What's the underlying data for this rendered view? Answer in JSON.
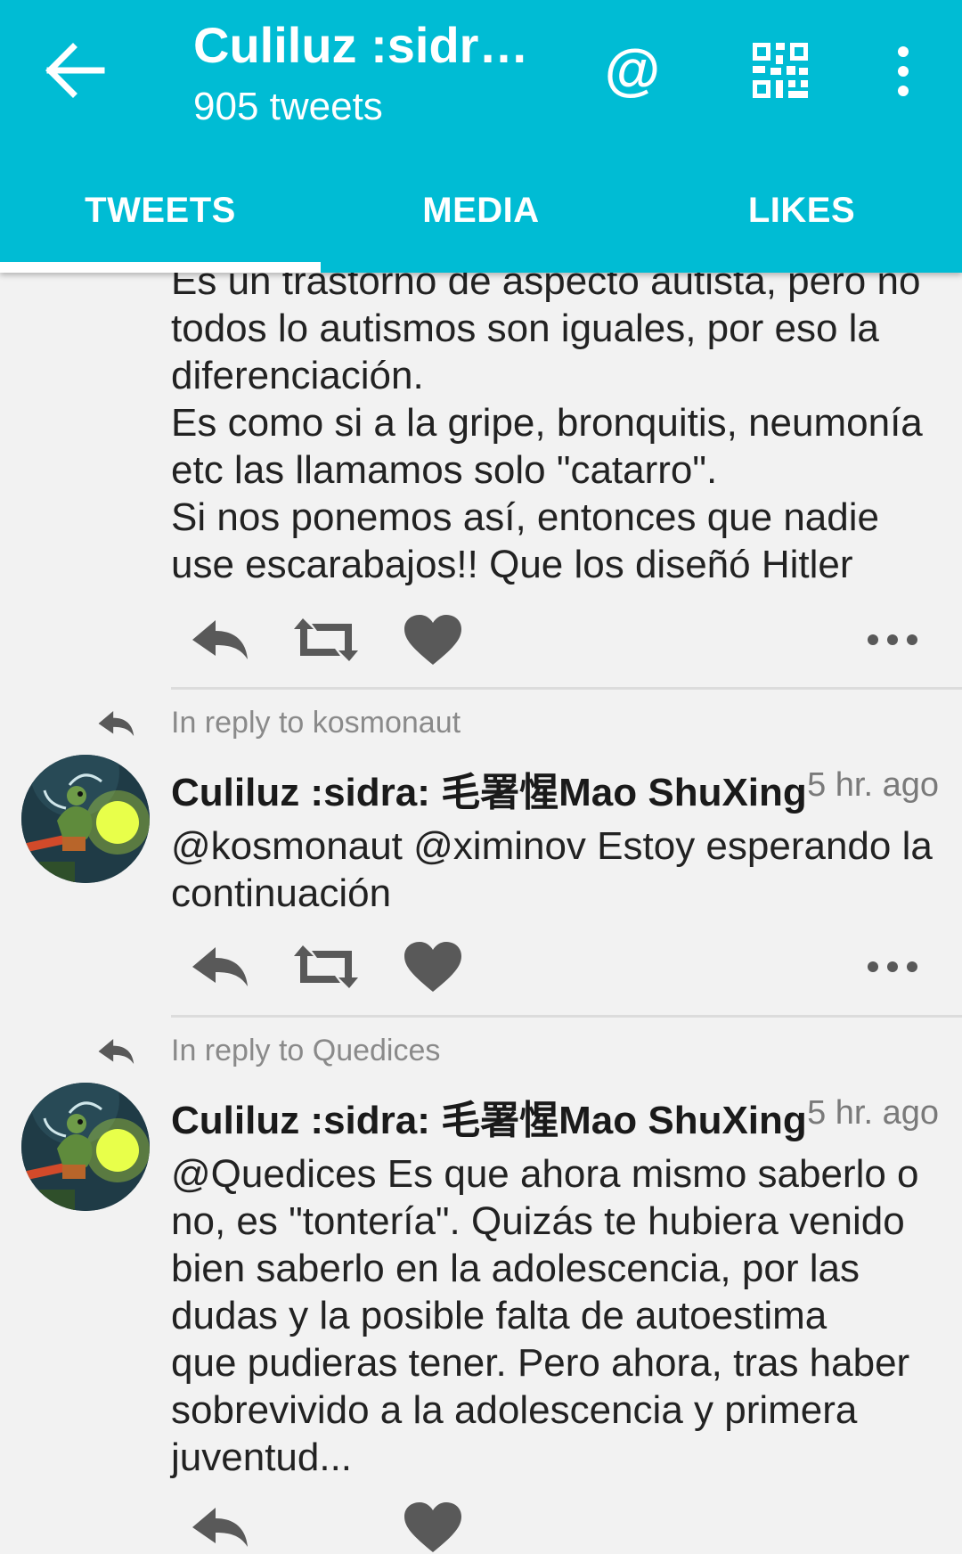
{
  "appbar": {
    "title": "Culiluz :sidr…",
    "subtitle": "905 tweets",
    "mention_symbol": "@",
    "back_icon": "arrow-left-icon",
    "qr_icon": "qr-code-icon",
    "more_icon": "more-vertical-icon",
    "background_color": "#00bcd4"
  },
  "tabs": [
    {
      "label": "TWEETS",
      "selected": true
    },
    {
      "label": "MEDIA",
      "selected": false
    },
    {
      "label": "LIKES",
      "selected": false
    }
  ],
  "tweets": [
    {
      "text": "Es un trastorno de aspecto autista, pero no\ntodos lo autismos son iguales, por eso la\ndiferenciación.\nEs como si a la gripe, bronquitis, neumonía\netc las llamamos solo \"catarro\".\nSi nos ponemos así, entonces que nadie\nuse escarabajos!! Que los diseñó Hitler"
    },
    {
      "reply_to": "In reply to kosmonaut",
      "author": "Culiluz :sidra: 毛署惺Mao ShuXing",
      "time": "5 hr. ago",
      "text": "@kosmonaut @ximinov Estoy esperando la\ncontinuación"
    },
    {
      "reply_to": "In reply to Quedices",
      "author": "Culiluz :sidra: 毛署惺Mao ShuXing",
      "time": "5 hr. ago",
      "text": "@Quedices Es que ahora mismo saberlo o\nno, es \"tontería\". Quizás te hubiera venido\nbien saberlo en la adolescencia, por las\ndudas y la posible falta de autoestima\nque pudieras tener. Pero ahora, tras haber\nsobrevivido a la adolescencia y primera\njuventud..."
    }
  ],
  "action_icons": [
    "reply-icon",
    "retweet-icon",
    "heart-icon",
    "more-horizontal-icon"
  ],
  "colors": {
    "icon_gray": "#595959",
    "text": "#222222",
    "meta": "#8a8a8a"
  }
}
